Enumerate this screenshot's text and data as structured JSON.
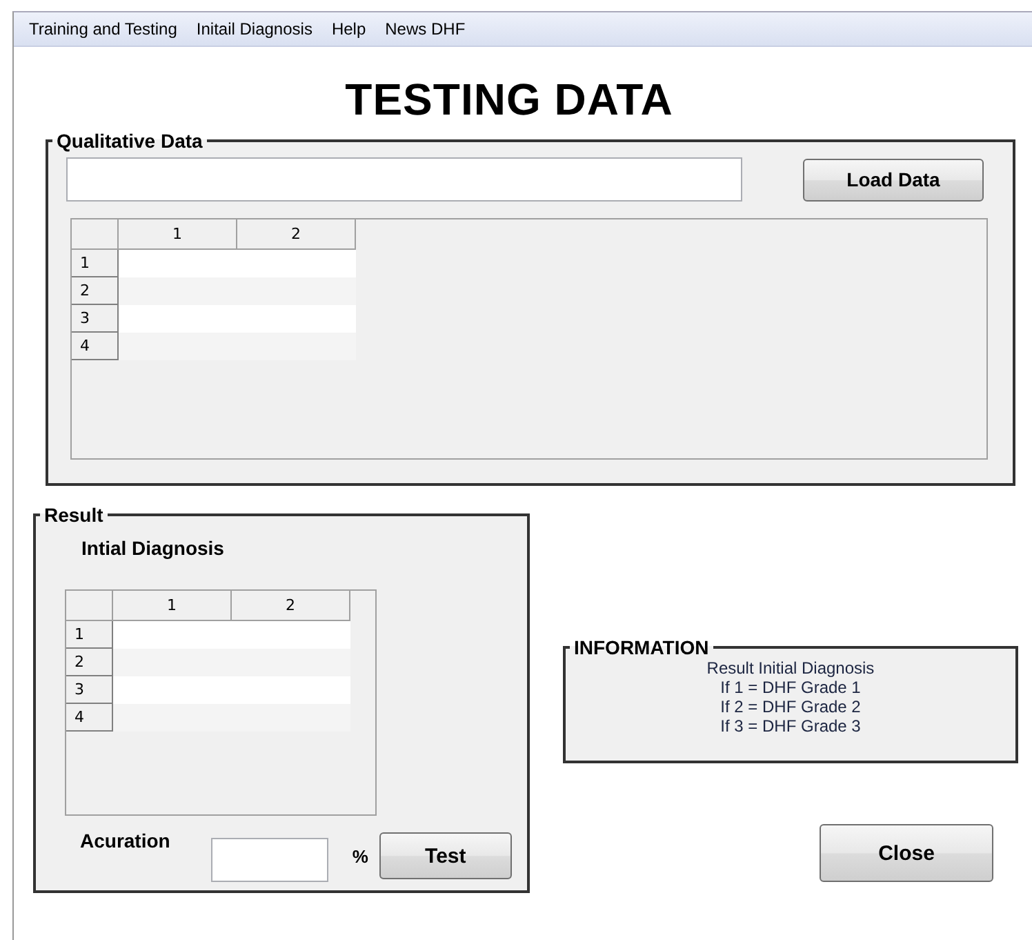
{
  "menu": [
    "Training and Testing",
    "Initail Diagnosis",
    "Help",
    "News DHF"
  ],
  "title": "TESTING DATA",
  "qualitative": {
    "legend": "Qualitative Data",
    "button": "Load Data",
    "table": {
      "columns": [
        "1",
        "2"
      ],
      "rows": [
        "1",
        "2",
        "3",
        "4"
      ]
    }
  },
  "result": {
    "legend": "Result",
    "subtitle": "Intial Diagnosis",
    "table": {
      "columns": [
        "1",
        "2"
      ],
      "rows": [
        "1",
        "2",
        "3",
        "4"
      ]
    },
    "accuracy_label": "Acuration",
    "unit": "%",
    "button": "Test"
  },
  "information": {
    "legend": "INFORMATION",
    "lines": [
      "Result Initial Diagnosis",
      "If 1 = DHF Grade 1",
      "If 2 = DHF Grade 2",
      "If 3 = DHF Grade 3"
    ]
  },
  "close_button": "Close"
}
